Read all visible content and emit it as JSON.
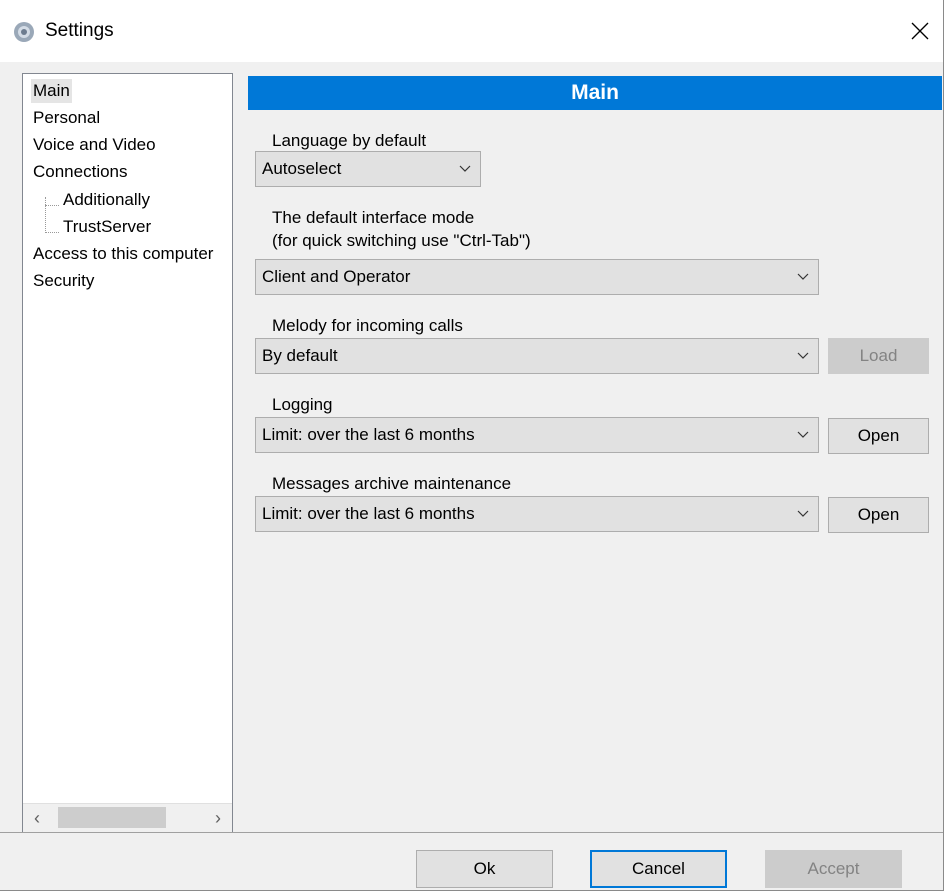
{
  "window": {
    "title": "Settings"
  },
  "sidebar": {
    "items": [
      {
        "label": "Main",
        "selected": true
      },
      {
        "label": "Personal"
      },
      {
        "label": "Voice and Video"
      },
      {
        "label": "Connections"
      },
      {
        "label": "Additionally",
        "child": true
      },
      {
        "label": "TrustServer",
        "child": true
      },
      {
        "label": "Access to this computer"
      },
      {
        "label": "Security"
      }
    ]
  },
  "main": {
    "header": "Main",
    "language": {
      "label": "Language by default",
      "value": "Autoselect"
    },
    "interface_mode": {
      "label_line1": "The default interface mode",
      "label_line2": "(for quick switching use \"Ctrl-Tab\")",
      "value": "Client and Operator"
    },
    "melody": {
      "label": "Melody for incoming calls",
      "value": "By default",
      "button": "Load"
    },
    "logging": {
      "label": "Logging",
      "value": "Limit: over the last 6 months",
      "button": "Open"
    },
    "archive": {
      "label": "Messages archive maintenance",
      "value": "Limit: over the last 6 months",
      "button": "Open"
    }
  },
  "footer": {
    "ok": "Ok",
    "cancel": "Cancel",
    "accept": "Accept"
  },
  "colors": {
    "accent": "#0078d7",
    "window_bg": "#f0f0f0"
  }
}
